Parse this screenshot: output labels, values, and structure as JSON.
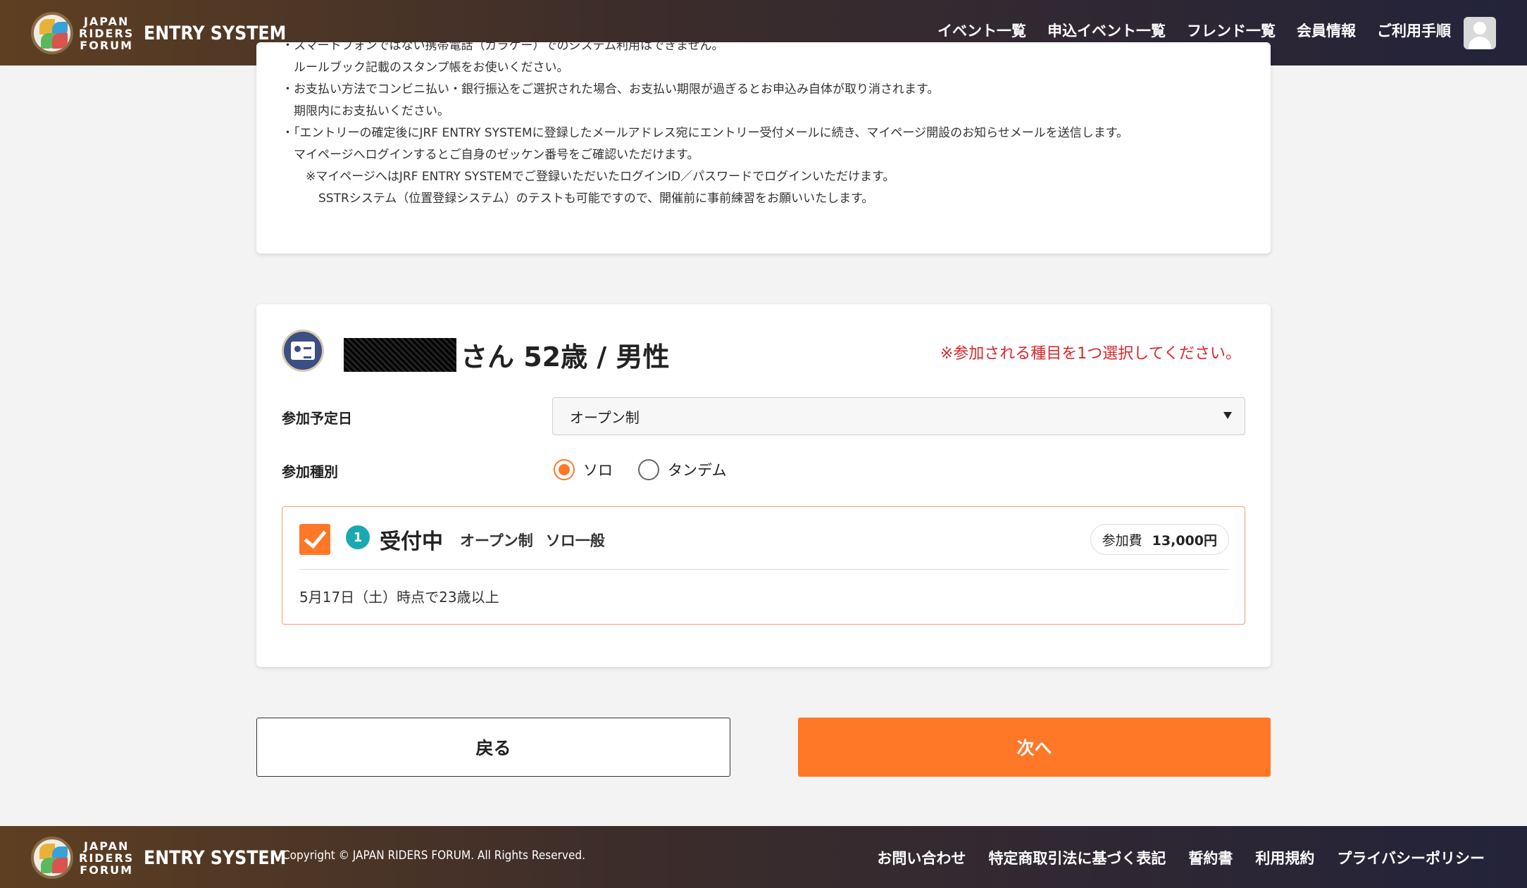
{
  "header": {
    "logo_words": [
      "JAPAN",
      "RIDERS",
      "FORUM"
    ],
    "logo_title": "ENTRY SYSTEM",
    "nav": [
      "イベント一覧",
      "申込イベント一覧",
      "フレンド一覧",
      "会員情報",
      "ご利用手順"
    ],
    "avatar_icon": "user-icon"
  },
  "notes": {
    "lines": [
      "・スマートフォンではない携帯電話（ガラケー）でのシステム利用はできません。",
      "ルールブック記載のスタンプ帳をお使いください。",
      "・お支払い方法でコンビニ払い・銀行振込をご選択された場合、お支払い期限が過ぎるとお申込み自体が取り消されます。",
      "期限内にお支払いください。",
      "・｢エントリーの確定後にJRF ENTRY SYSTEMに登録したメールアドレス宛にエントリー受付メールに続き、マイページ開設のお知らせメールを送信します。",
      "マイページへログインするとご自身のゼッケン番号をご確認いただけます。",
      "※マイページへはJRF ENTRY SYSTEMでご登録いただいたログインID／パスワードでログインいただけます。",
      "SSTRシステム（位置登録システム）のテストも可能ですので、開催前に事前練習をお願いいたします。"
    ]
  },
  "entry": {
    "icon": "id-card-icon",
    "name_suffix": "さん 52歳 / 男性",
    "warning": "※参加される種目を1つ選択してください。",
    "date_label": "参加予定日",
    "date_value": "オープン制",
    "type_label": "参加種別",
    "type_options": [
      "ソロ",
      "タンデム"
    ],
    "type_selected": "ソロ",
    "option": {
      "number": "1",
      "status": "受付中",
      "desc1": "オープン制",
      "desc2": "ソロ一般",
      "fee_label": "参加費",
      "fee_amount": "13,000円",
      "checked": true,
      "note": "5月17日（土）時点で23歳以上"
    }
  },
  "buttons": {
    "back": "戻る",
    "next": "次へ"
  },
  "footer": {
    "logo_words": [
      "JAPAN",
      "RIDERS",
      "FORUM"
    ],
    "logo_title": "ENTRY SYSTEM",
    "copyright": "Copyright © JAPAN RIDERS FORUM. All Rights Reserved.",
    "links": [
      "お問い合わせ",
      "特定商取引法に基づく表記",
      "誓約書",
      "利用規約",
      "プライバシーポリシー"
    ]
  },
  "colors": {
    "accent": "#ff7828",
    "warning": "#d8262c",
    "teal": "#1aa9b0"
  }
}
